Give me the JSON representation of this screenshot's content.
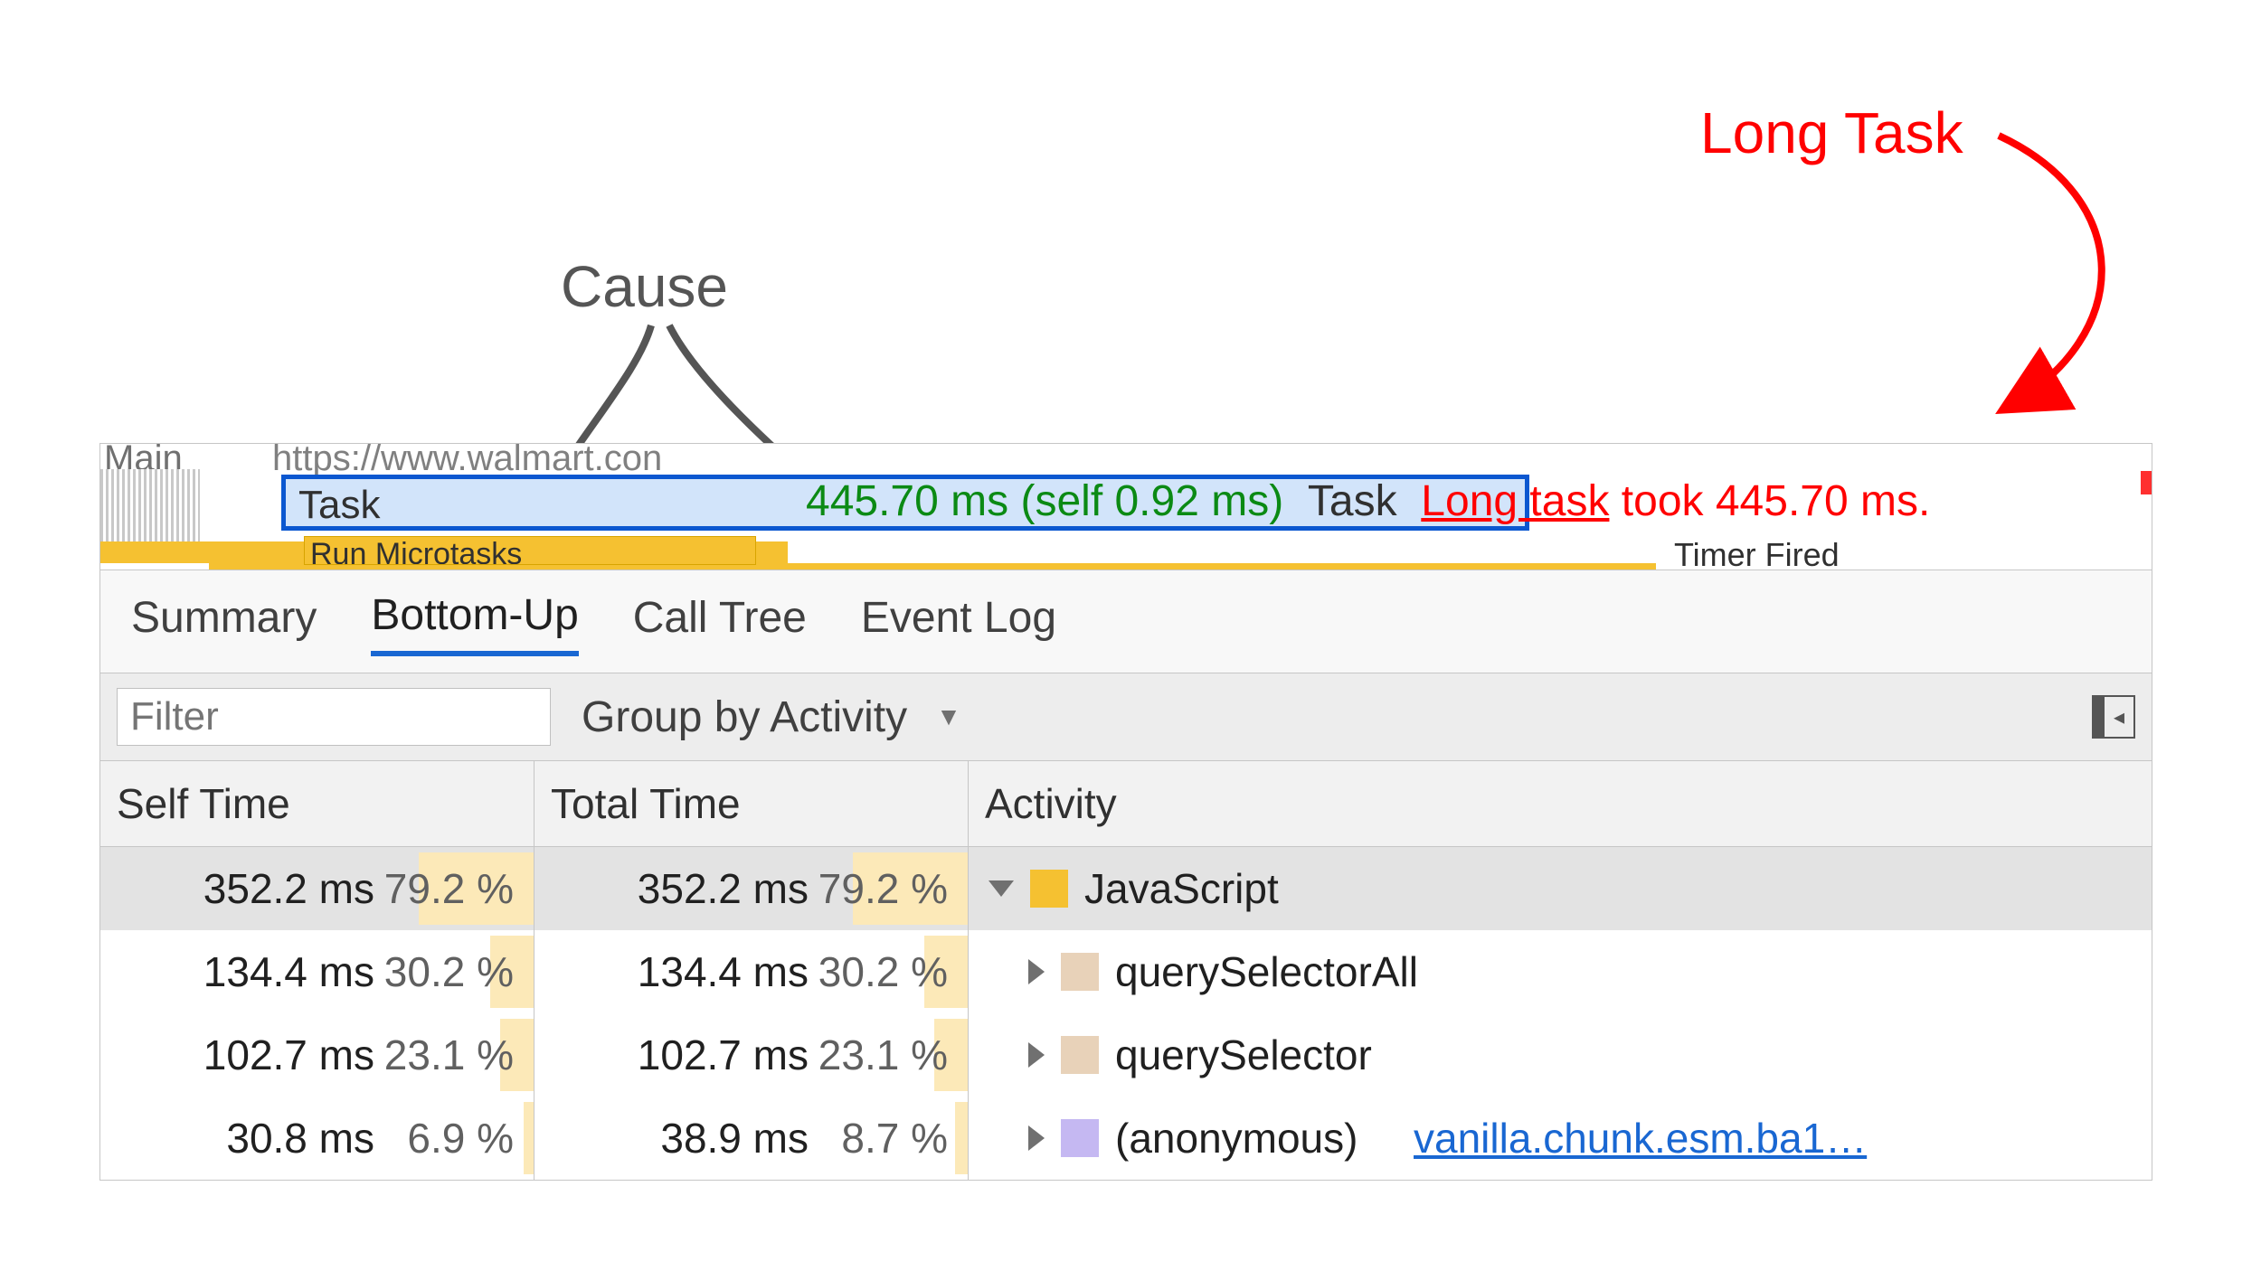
{
  "annotations": {
    "long_task": "Long Task",
    "cause": "Cause"
  },
  "timeline": {
    "track_label": "Main",
    "url_fragment": "https://www.walmart.con",
    "task_label": "Task",
    "microtask_label": "Run Microtasks",
    "timer_fired_fragment": "Timer Fired",
    "tooltip": {
      "duration": "445.70 ms (self 0.92 ms)",
      "task_word": "Task",
      "warn_prefix": "Long task",
      "warn_suffix": " took 445.70 ms."
    }
  },
  "tabs": [
    "Summary",
    "Bottom-Up",
    "Call Tree",
    "Event Log"
  ],
  "active_tab_index": 1,
  "toolbar": {
    "filter_placeholder": "Filter",
    "group_label": "Group by Activity"
  },
  "columns": [
    "Self Time",
    "Total Time",
    "Activity"
  ],
  "rows": [
    {
      "self_ms": "352.2 ms",
      "self_pct": "79.2 %",
      "self_bar_pct": 79.2,
      "total_ms": "352.2 ms",
      "total_pct": "79.2 %",
      "total_bar_pct": 79.2,
      "expanded": true,
      "indent": 0,
      "swatch": "js",
      "activity": "JavaScript",
      "link": null,
      "selected": true
    },
    {
      "self_ms": "134.4 ms",
      "self_pct": "30.2 %",
      "self_bar_pct": 30.2,
      "total_ms": "134.4 ms",
      "total_pct": "30.2 %",
      "total_bar_pct": 30.2,
      "expanded": false,
      "indent": 1,
      "swatch": "tan",
      "activity": "querySelectorAll",
      "link": null,
      "selected": false
    },
    {
      "self_ms": "102.7 ms",
      "self_pct": "23.1 %",
      "self_bar_pct": 23.1,
      "total_ms": "102.7 ms",
      "total_pct": "23.1 %",
      "total_bar_pct": 23.1,
      "expanded": false,
      "indent": 1,
      "swatch": "tan",
      "activity": "querySelector",
      "link": null,
      "selected": false
    },
    {
      "self_ms": "30.8 ms",
      "self_pct": "6.9 %",
      "self_bar_pct": 6.9,
      "total_ms": "38.9 ms",
      "total_pct": "8.7 %",
      "total_bar_pct": 8.7,
      "expanded": false,
      "indent": 1,
      "swatch": "lil",
      "activity": "(anonymous)",
      "link": "vanilla.chunk.esm.ba1…",
      "selected": false
    }
  ]
}
